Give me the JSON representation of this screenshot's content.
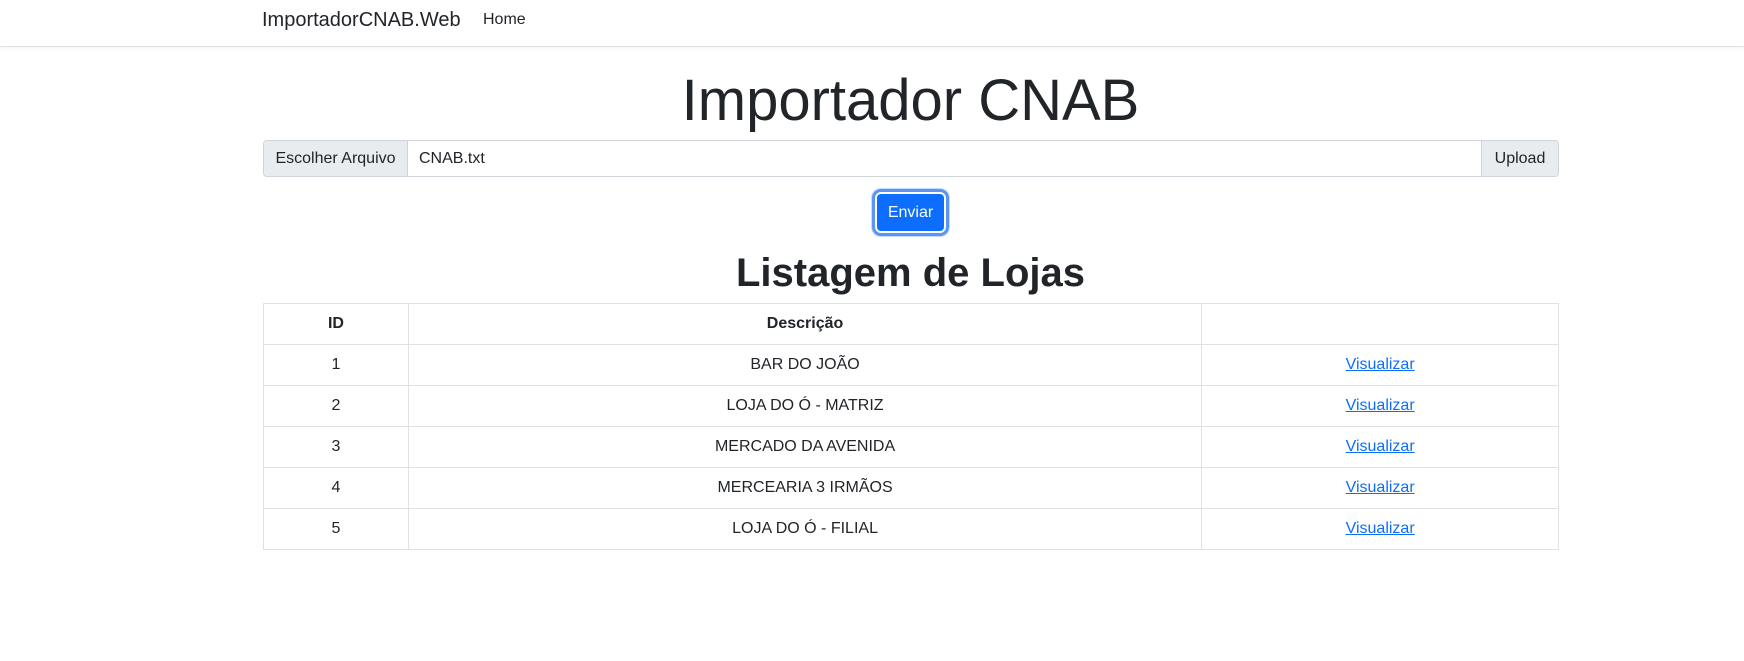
{
  "navbar": {
    "brand": "ImportadorCNAB.Web",
    "home": "Home"
  },
  "main": {
    "title": "Importador CNAB",
    "upload": {
      "choose_label": "Escolher Arquivo",
      "file_name": "CNAB.txt",
      "upload_label": "Upload"
    },
    "send_label": "Enviar",
    "list_title": "Listagem de Lojas",
    "table": {
      "headers": [
        "ID",
        "Descrição",
        ""
      ],
      "rows": [
        {
          "id": "1",
          "description": "BAR DO JOÃO",
          "action": "Visualizar"
        },
        {
          "id": "2",
          "description": "LOJA DO Ó - MATRIZ",
          "action": "Visualizar"
        },
        {
          "id": "3",
          "description": "MERCADO DA AVENIDA",
          "action": "Visualizar"
        },
        {
          "id": "4",
          "description": "MERCEARIA 3 IRMÃOS",
          "action": "Visualizar"
        },
        {
          "id": "5",
          "description": "LOJA DO Ó - FILIAL",
          "action": "Visualizar"
        }
      ]
    }
  },
  "colors": {
    "primary": "#0d6efd",
    "border": "#dee2e6",
    "text": "#212529"
  }
}
